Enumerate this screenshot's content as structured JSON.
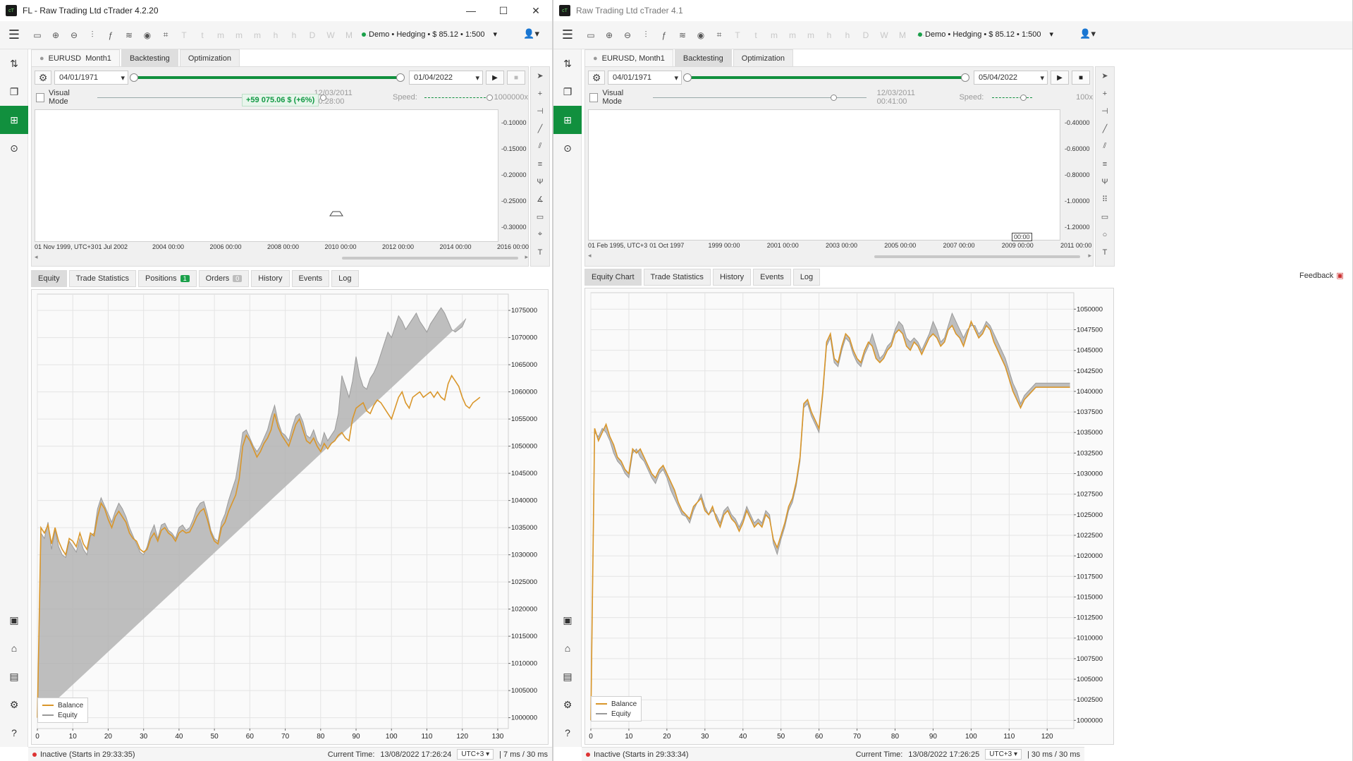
{
  "left": {
    "title": "FL - Raw Trading Ltd cTrader 4.2.20",
    "account": "Demo • Hedging • $ 85.12 • 1:500",
    "tabs": {
      "symbol": "EURUSD",
      "period": "Month1",
      "backtesting": "Backtesting",
      "optimization": "Optimization"
    },
    "start_date": "04/01/1971",
    "end_date": "01/04/2022",
    "visual_mode": "Visual Mode",
    "current_date": "12/03/2011 00:28:00",
    "speed_label": "Speed:",
    "speed_value": "1000000x",
    "profit_badge": "+59 075.06 $ (+6%)",
    "scale": [
      "0.1000",
      "0.1500",
      "0.2000",
      "0.2500",
      "0.3000"
    ],
    "scale_suffix": "0",
    "xlabels": [
      "01 Nov 1999, UTC+3",
      "01 Jul 2002",
      "2004 00:00",
      "2006 00:00",
      "2008 00:00",
      "2010 00:00",
      "2012 00:00",
      "2014 00:00",
      "2016 00:00"
    ],
    "bottom_tabs": {
      "equity": "Equity",
      "trade_stats": "Trade Statistics",
      "positions": "Positions",
      "positions_count": "1",
      "orders": "Orders",
      "orders_count": "0",
      "history": "History",
      "events": "Events",
      "log": "Log"
    },
    "status": {
      "inactive": "Inactive (Starts in 29:33:35)",
      "current_time_label": "Current Time:",
      "current_time": "13/08/2022 17:26:24",
      "utc": "UTC+3",
      "latency": "| 7 ms / 30 ms"
    }
  },
  "right": {
    "title": "Raw Trading Ltd cTrader 4.1",
    "account": "Demo • Hedging • $ 85.12 • 1:500",
    "tabs": {
      "symbol": "EURUSD, Month1",
      "backtesting": "Backtesting",
      "optimization": "Optimization"
    },
    "start_date": "04/01/1971",
    "end_date": "05/04/2022",
    "visual_mode": "Visual Mode",
    "current_date": "12/03/2011 00:41:00",
    "speed_label": "Speed:",
    "speed_value": "100x",
    "scale": [
      "0.4000",
      "0.6000",
      "0.8000",
      "1.0000",
      "1.2000"
    ],
    "scale_prefix": "-",
    "scale_suffix": "0",
    "xlabels": [
      "01 Feb 1995, UTC+3",
      "01 Oct 1997",
      "1999 00:00",
      "2001 00:00",
      "2003 00:00",
      "2005 00:00",
      "2007 00:00",
      "2009 00:00",
      "2011 00:00"
    ],
    "crosshair_label": "00:00",
    "bottom_tabs": {
      "equity": "Equity Chart",
      "trade_stats": "Trade Statistics",
      "history": "History",
      "events": "Events",
      "log": "Log"
    },
    "feedback": "Feedback",
    "status": {
      "inactive": "Inactive (Starts in 29:33:34)",
      "current_time_label": "Current Time:",
      "current_time": "13/08/2022 17:26:25",
      "utc": "UTC+3",
      "latency": "| 30 ms / 30 ms"
    }
  },
  "legend": {
    "balance": "Balance",
    "equity": "Equity"
  },
  "colors": {
    "balance": "#d9962a",
    "equity_fill": "#b3b3b3",
    "equity_line": "#9a9a9a",
    "accent": "#11903e"
  },
  "chart_data": [
    {
      "type": "line",
      "title": "",
      "x": [
        0,
        1,
        2,
        3,
        4,
        5,
        6,
        7,
        8,
        9,
        10,
        11,
        12,
        13,
        14,
        15,
        16,
        17,
        18,
        19,
        20,
        21,
        22,
        23,
        24,
        25,
        26,
        27,
        28,
        29,
        30,
        31,
        32,
        33,
        34,
        35,
        36,
        37,
        38,
        39,
        40,
        41,
        42,
        43,
        44,
        45,
        46,
        47,
        48,
        49,
        50,
        51,
        52,
        53,
        54,
        55,
        56,
        57,
        58,
        59,
        60,
        61,
        62,
        63,
        64,
        65,
        66,
        67,
        68,
        69,
        70,
        71,
        72,
        73,
        74,
        75,
        76,
        77,
        78,
        79,
        80,
        81,
        82,
        83,
        84,
        85,
        86,
        87,
        88,
        89,
        90,
        91,
        92,
        93,
        94,
        95,
        96,
        97,
        98,
        99,
        100,
        101,
        102,
        103,
        104,
        105,
        106,
        107,
        108,
        109,
        110,
        111,
        112,
        113,
        114,
        115,
        116,
        117,
        118,
        119,
        120,
        121,
        122,
        123,
        124,
        125,
        126,
        127,
        128,
        129,
        130,
        131,
        132
      ],
      "series": [
        {
          "name": "Balance",
          "values": [
            1000000,
            1035000,
            1034000,
            1035500,
            1032000,
            1035000,
            1032500,
            1031000,
            1030000,
            1033000,
            1032500,
            1031500,
            1034000,
            1032000,
            1031000,
            1034000,
            1033500,
            1037000,
            1039500,
            1038500,
            1036500,
            1035000,
            1037000,
            1038000,
            1037000,
            1036000,
            1034000,
            1033000,
            1032500,
            1031000,
            1030500,
            1031000,
            1033000,
            1034000,
            1032500,
            1034500,
            1035000,
            1034000,
            1033500,
            1032500,
            1034000,
            1034500,
            1034000,
            1034200,
            1035500,
            1037000,
            1038000,
            1038500,
            1036500,
            1034000,
            1032500,
            1032000,
            1035000,
            1036000,
            1038000,
            1039500,
            1041000,
            1044000,
            1050000,
            1052000,
            1051000,
            1049500,
            1048000,
            1049000,
            1050500,
            1051500,
            1053000,
            1056000,
            1053500,
            1052000,
            1051000,
            1050000,
            1052000,
            1054000,
            1055000,
            1053000,
            1051000,
            1050500,
            1051500,
            1050000,
            1049000,
            1050500,
            1049500,
            1050500,
            1051000,
            1052000,
            1052500,
            1051500,
            1051000,
            1055000,
            1057000,
            1057500,
            1058000,
            1056500,
            1056000,
            1057500,
            1058500,
            1058000,
            1057000,
            1056000,
            1055000,
            1057000,
            1059000,
            1060000,
            1058000,
            1057000,
            1059000,
            1059500,
            1060000,
            1059000,
            1059500,
            1060000,
            1059000,
            1060000,
            1059000,
            1058500,
            1061500,
            1063000,
            1062000,
            1061000,
            1059000,
            1057500,
            1057000,
            1058000,
            1058500,
            1059000
          ]
        },
        {
          "name": "Equity",
          "values": [
            1000000,
            1034000,
            1033000,
            1036000,
            1031000,
            1034500,
            1031500,
            1030000,
            1029500,
            1032500,
            1031500,
            1030500,
            1033000,
            1031000,
            1030000,
            1033500,
            1034000,
            1038500,
            1040500,
            1039000,
            1037500,
            1036000,
            1038000,
            1039500,
            1038500,
            1037000,
            1035000,
            1033500,
            1032000,
            1030500,
            1030000,
            1031500,
            1034000,
            1035500,
            1033000,
            1035500,
            1035800,
            1034500,
            1034000,
            1033000,
            1035000,
            1035500,
            1034500,
            1035000,
            1036500,
            1038500,
            1039500,
            1039800,
            1037500,
            1034500,
            1033000,
            1032500,
            1036000,
            1037500,
            1040000,
            1042000,
            1044000,
            1048000,
            1052500,
            1053000,
            1051500,
            1050000,
            1049000,
            1050000,
            1051500,
            1053000,
            1055500,
            1057500,
            1054500,
            1052500,
            1052000,
            1051000,
            1053500,
            1055500,
            1056000,
            1054500,
            1052000,
            1051500,
            1053000,
            1051000,
            1050000,
            1052500,
            1051000,
            1052000,
            1053000,
            1056000,
            1063000,
            1061000,
            1059000,
            1062000,
            1066500,
            1063000,
            1061000,
            1060500,
            1062500,
            1063500,
            1065000,
            1067000,
            1069000,
            1071000,
            1070000,
            1072000,
            1074000,
            1073000,
            1071500,
            1072500,
            1073500,
            1074500,
            1073000,
            1072000,
            1071000,
            1072500,
            1073500,
            1074500,
            1075500,
            1074500,
            1073000,
            1071500,
            1071000,
            1071500,
            1072000,
            1073500
          ]
        }
      ],
      "xlim": [
        0,
        133
      ],
      "ylim": [
        998000,
        1078000
      ],
      "xticks": [
        0,
        10,
        20,
        30,
        40,
        50,
        60,
        70,
        80,
        90,
        100,
        110,
        120,
        130
      ],
      "yticks": [
        1000000,
        1005000,
        1010000,
        1015000,
        1020000,
        1025000,
        1030000,
        1035000,
        1040000,
        1045000,
        1050000,
        1055000,
        1060000,
        1065000,
        1070000,
        1075000
      ],
      "legend": "bottom-left",
      "grid": true
    },
    {
      "type": "line",
      "title": "",
      "x": [
        0,
        1,
        2,
        3,
        4,
        5,
        6,
        7,
        8,
        9,
        10,
        11,
        12,
        13,
        14,
        15,
        16,
        17,
        18,
        19,
        20,
        21,
        22,
        23,
        24,
        25,
        26,
        27,
        28,
        29,
        30,
        31,
        32,
        33,
        34,
        35,
        36,
        37,
        38,
        39,
        40,
        41,
        42,
        43,
        44,
        45,
        46,
        47,
        48,
        49,
        50,
        51,
        52,
        53,
        54,
        55,
        56,
        57,
        58,
        59,
        60,
        61,
        62,
        63,
        64,
        65,
        66,
        67,
        68,
        69,
        70,
        71,
        72,
        73,
        74,
        75,
        76,
        77,
        78,
        79,
        80,
        81,
        82,
        83,
        84,
        85,
        86,
        87,
        88,
        89,
        90,
        91,
        92,
        93,
        94,
        95,
        96,
        97,
        98,
        99,
        100,
        101,
        102,
        103,
        104,
        105,
        106,
        107,
        108,
        109,
        110,
        111,
        112,
        113,
        114,
        115,
        116,
        117,
        118,
        119,
        120,
        121,
        122,
        123,
        124,
        125,
        126
      ],
      "series": [
        {
          "name": "Balance",
          "values": [
            1000000,
            1035500,
            1034000,
            1035000,
            1036000,
            1034500,
            1033500,
            1032000,
            1031500,
            1030500,
            1030000,
            1033000,
            1032500,
            1033000,
            1032000,
            1031000,
            1030000,
            1029500,
            1030500,
            1031000,
            1030000,
            1029000,
            1028000,
            1026500,
            1025500,
            1025000,
            1024500,
            1026000,
            1026500,
            1027000,
            1025500,
            1025000,
            1026000,
            1024500,
            1023500,
            1025000,
            1025500,
            1024500,
            1024000,
            1023000,
            1024000,
            1025500,
            1024500,
            1023500,
            1024000,
            1023500,
            1025000,
            1024500,
            1022000,
            1021000,
            1022500,
            1024000,
            1026000,
            1027000,
            1029000,
            1032000,
            1038500,
            1039000,
            1037500,
            1036500,
            1035500,
            1040000,
            1046000,
            1047000,
            1044000,
            1043500,
            1045500,
            1047000,
            1046500,
            1045000,
            1044000,
            1043500,
            1045000,
            1046000,
            1045500,
            1044000,
            1043500,
            1044000,
            1045000,
            1045500,
            1047000,
            1047500,
            1047000,
            1045500,
            1045000,
            1046000,
            1045500,
            1044500,
            1045500,
            1046500,
            1047000,
            1046500,
            1045500,
            1046000,
            1047500,
            1048000,
            1047000,
            1046500,
            1045500,
            1047000,
            1048500,
            1047500,
            1046500,
            1047000,
            1048000,
            1047500,
            1046000,
            1045000,
            1044000,
            1043000,
            1041500,
            1040000,
            1039000,
            1038000,
            1039000,
            1039500,
            1040000,
            1040500,
            1040500,
            1040500,
            1040500,
            1040500,
            1040500,
            1040500,
            1040500,
            1040500,
            1040500
          ]
        },
        {
          "name": "Equity",
          "values": [
            1000000,
            1035000,
            1034500,
            1035500,
            1035000,
            1034000,
            1032500,
            1031500,
            1031000,
            1030000,
            1029500,
            1032500,
            1033000,
            1032000,
            1031500,
            1030500,
            1029500,
            1028800,
            1030000,
            1030500,
            1029500,
            1028000,
            1027000,
            1026000,
            1025000,
            1024800,
            1024000,
            1025500,
            1026500,
            1027500,
            1026000,
            1025000,
            1025500,
            1025000,
            1024000,
            1025500,
            1026000,
            1025000,
            1024500,
            1023500,
            1024500,
            1026000,
            1025000,
            1024000,
            1024500,
            1024000,
            1025500,
            1025000,
            1021500,
            1020200,
            1022000,
            1023500,
            1025500,
            1026500,
            1028500,
            1031500,
            1038000,
            1038500,
            1037000,
            1036000,
            1035000,
            1039500,
            1045500,
            1046500,
            1043500,
            1043000,
            1045000,
            1046500,
            1046000,
            1044500,
            1043500,
            1043000,
            1044500,
            1045500,
            1047000,
            1045500,
            1044000,
            1044500,
            1045500,
            1046000,
            1047500,
            1048500,
            1048000,
            1046500,
            1046000,
            1046500,
            1046000,
            1045000,
            1046000,
            1047000,
            1048500,
            1047500,
            1046000,
            1046500,
            1048000,
            1049500,
            1048500,
            1047500,
            1046500,
            1047500,
            1048000,
            1048000,
            1047000,
            1047500,
            1048500,
            1048000,
            1047000,
            1046000,
            1045000,
            1044000,
            1042500,
            1041000,
            1040000,
            1038500,
            1039500,
            1040000,
            1040500,
            1041000,
            1041000,
            1041000,
            1041000,
            1041000,
            1041000,
            1041000,
            1041000,
            1041000,
            1041000
          ]
        }
      ],
      "xlim": [
        0,
        127
      ],
      "ylim": [
        999000,
        1052000
      ],
      "xticks": [
        0,
        10,
        20,
        30,
        40,
        50,
        60,
        70,
        80,
        90,
        100,
        110,
        120
      ],
      "yticks": [
        1000000,
        1002500,
        1005000,
        1007500,
        1010000,
        1012500,
        1015000,
        1017500,
        1020000,
        1022500,
        1025000,
        1027500,
        1030000,
        1032500,
        1035000,
        1037500,
        1040000,
        1042500,
        1045000,
        1047500,
        1050000
      ],
      "legend": "bottom-left",
      "grid": true
    }
  ]
}
